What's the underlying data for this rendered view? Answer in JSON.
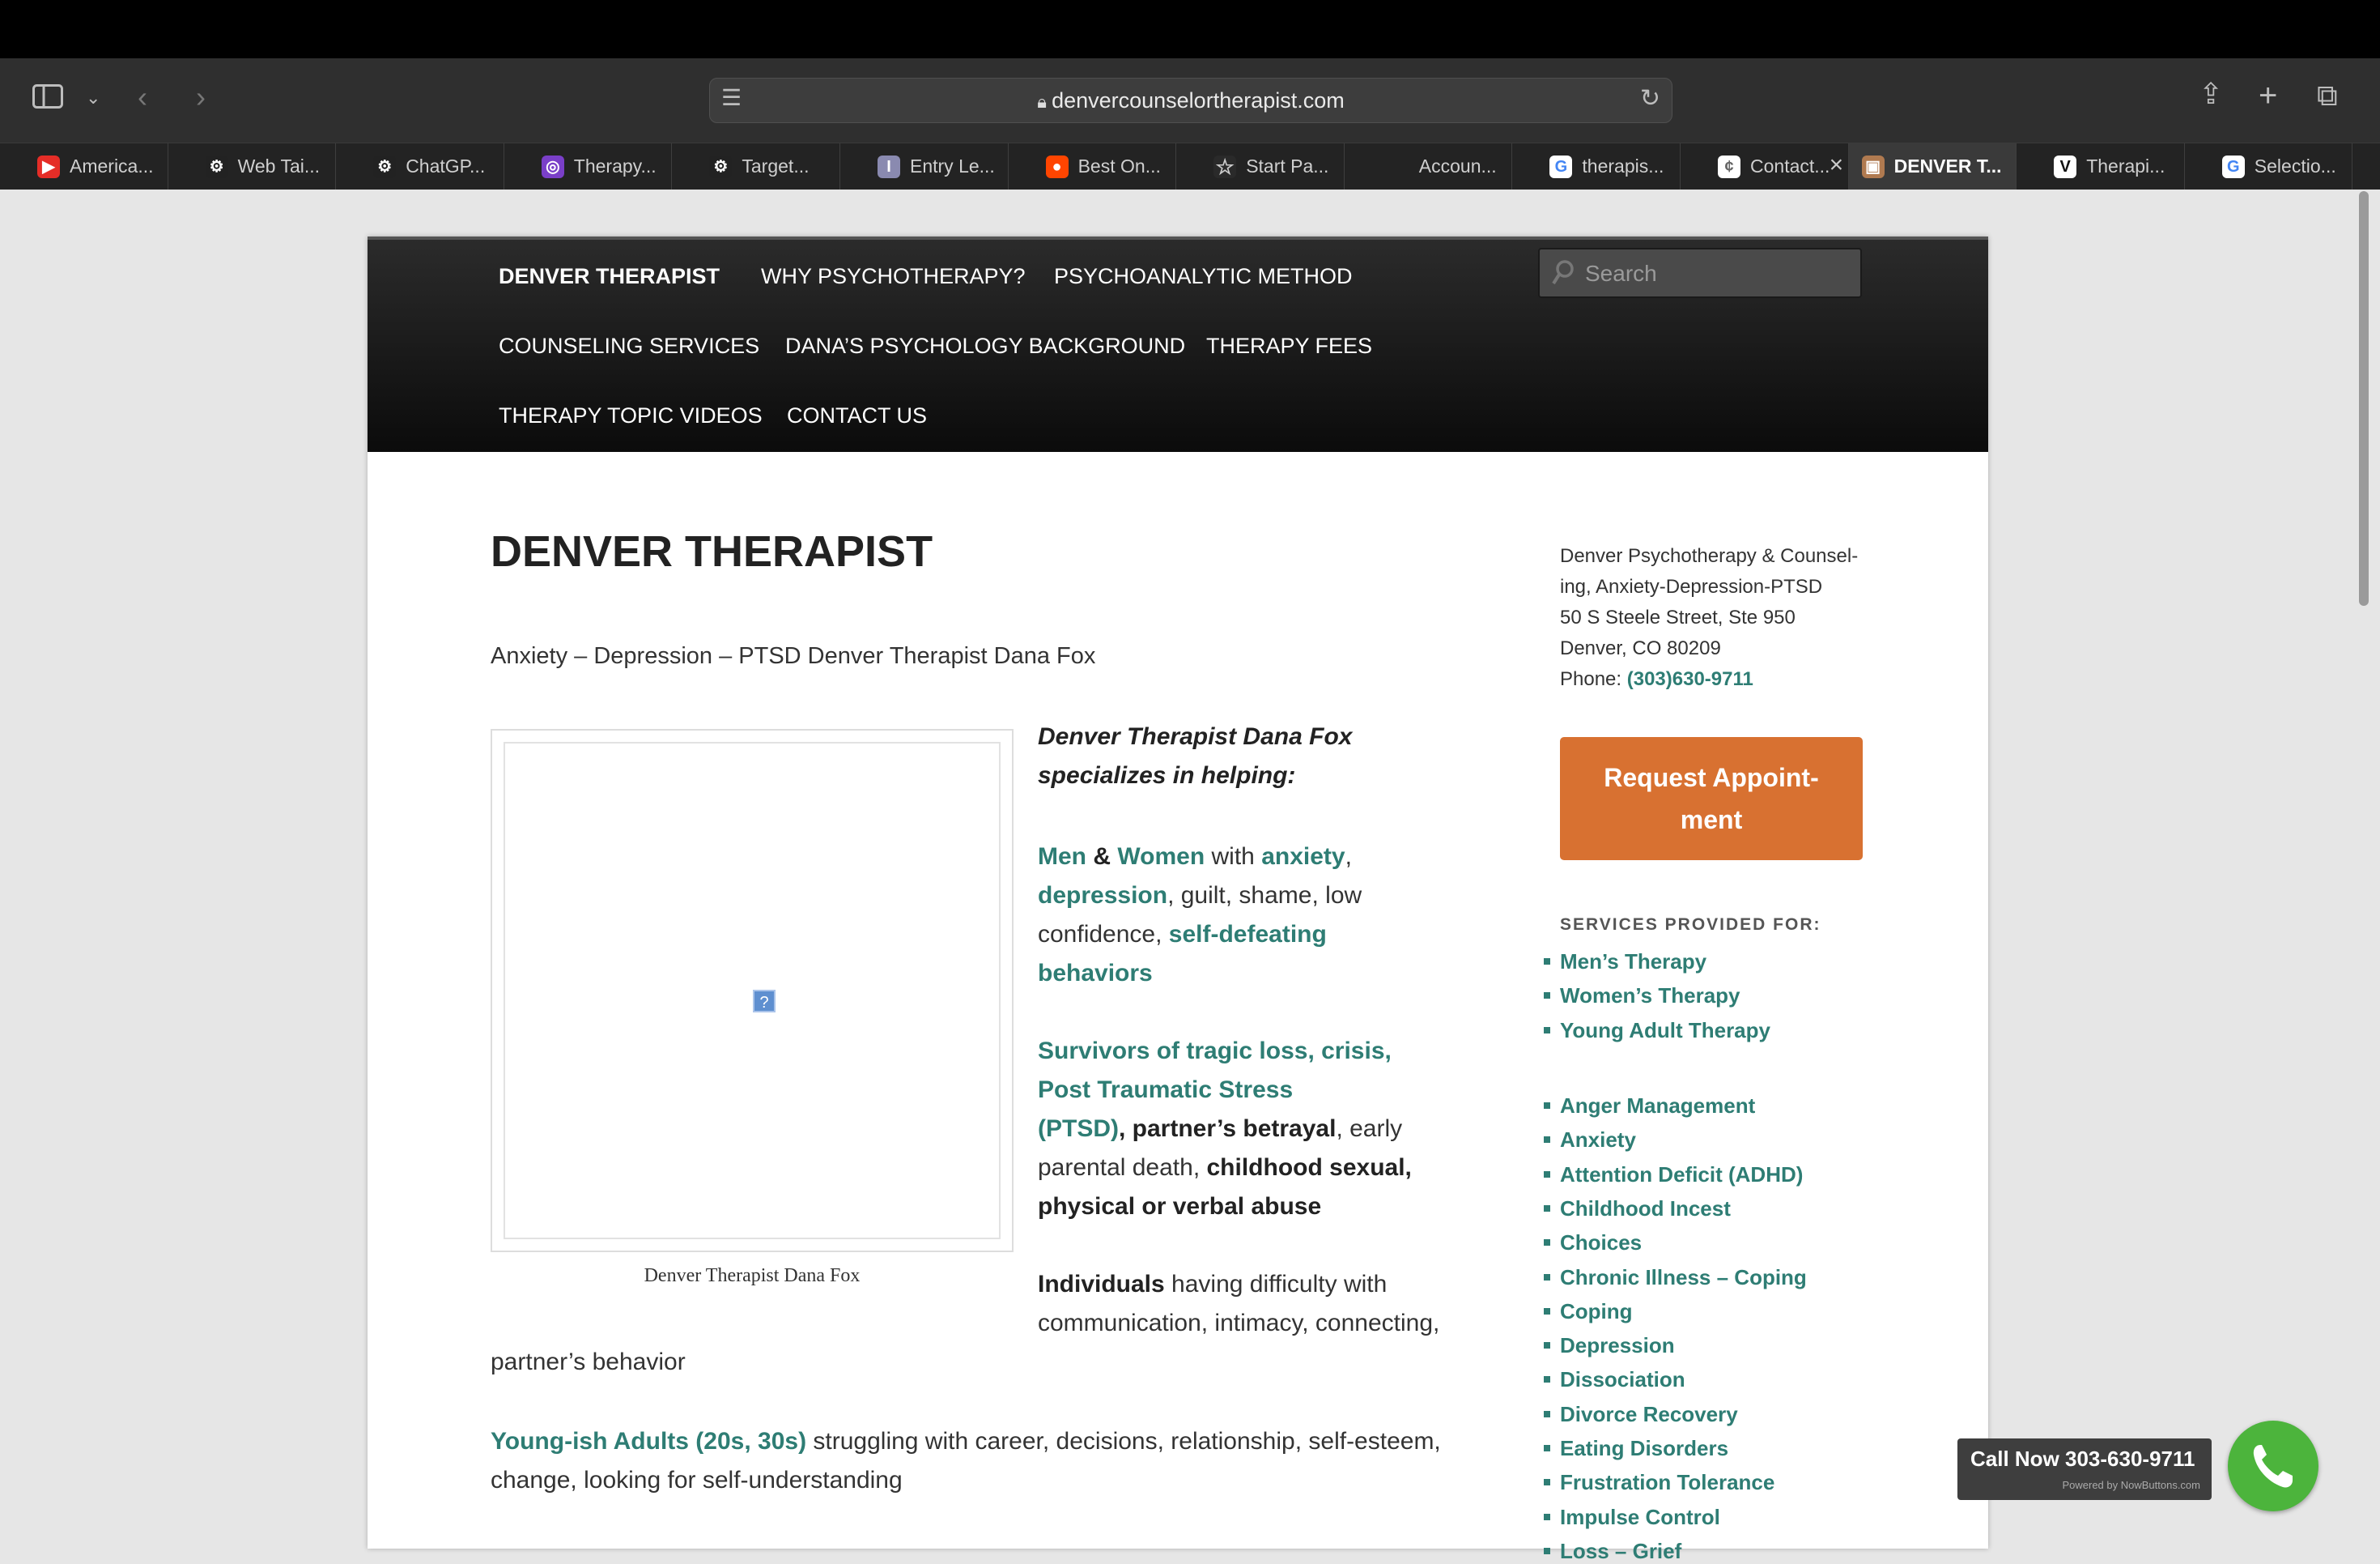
{
  "browser": {
    "url": "denvercounselortherapist.com",
    "tabs": [
      {
        "label": "America...",
        "icon": "youtube-icon",
        "color": "#e52d27"
      },
      {
        "label": "Web Tai...",
        "icon": "openai-icon",
        "color": "#222222"
      },
      {
        "label": "ChatGP...",
        "icon": "openai-icon",
        "color": "#222222"
      },
      {
        "label": "Therapy...",
        "icon": "circle-logo-icon",
        "color": "#7a3fc8"
      },
      {
        "label": "Target...",
        "icon": "openai-icon",
        "color": "#222222"
      },
      {
        "label": "Entry Le...",
        "icon": "i-letter-icon",
        "color": "#8a8ab0"
      },
      {
        "label": "Best On...",
        "icon": "reddit-icon",
        "color": "#ff4500"
      },
      {
        "label": "Start Pa...",
        "icon": "star-icon",
        "color": "#2a2a2a"
      },
      {
        "label": "Accoun...",
        "icon": "",
        "color": "#2a2a2a"
      },
      {
        "label": "therapis...",
        "icon": "google-icon",
        "color": "#ffffff"
      },
      {
        "label": "Contact...",
        "icon": "page-icon",
        "color": "#ffffff"
      },
      {
        "label": "DENVER T...",
        "icon": "site-favicon",
        "color": "#b07a50"
      },
      {
        "label": "Therapi...",
        "icon": "vo-icon",
        "color": "#ffffff"
      },
      {
        "label": "Selectio...",
        "icon": "google-icon",
        "color": "#ffffff"
      }
    ]
  },
  "nav": {
    "items": [
      "DENVER THERAPIST",
      "WHY PSYCHOTHERAPY?",
      "PSYCHOANALYTIC METHOD",
      "COUNSELING SERVICES",
      "DANA’S PSYCHOLOGY BACKGROUND",
      "THERAPY FEES",
      "THERAPY TOPIC VIDEOS",
      "CONTACT US"
    ],
    "search_placeholder": "Search"
  },
  "main": {
    "title": "DENVER THERAPIST",
    "subtitle": "Anxiety – Depression – PTSD Denver Therapist Dana Fox",
    "image_caption": "Denver Therapist Dana Fox",
    "intro_line1": "Denver Therapist  Dana Fox",
    "intro_line2": "specializes in helping:",
    "p1": {
      "men": "Men",
      "amp": "&",
      "women": "Women",
      "with": "with",
      "anxiety": "anxiety",
      "comma1": ",",
      "depression": "depression",
      "guilt": ", guilt, shame, low",
      "confidence": "confidence, ",
      "selfdefeating": "self-defeating",
      "behaviors": "behaviors"
    },
    "p2": {
      "l1": "Survivors of tragic loss, crisis,",
      "l2": "Post Traumatic Stress",
      "l3a": "(PTSD)",
      "l3b": ", partner’s betrayal",
      "l3c": ", early",
      "l4a": "parental death, ",
      "l4b": "childhood sexual,",
      "l5": "physical or verbal abuse"
    },
    "p3": {
      "individuals": "Individuals",
      "l1rest": " having difficulty with",
      "l2": "communication, intimacy, connecting,",
      "l3": "partner’s behavior"
    },
    "p4": {
      "young": "Young-ish Adults (20s, 30s)",
      "l1rest": " struggling with career, decisions, relationship, self-esteem,",
      "l2": "change, looking for self-understanding"
    }
  },
  "sidebar": {
    "address_lines": [
      "Denver Psychotherapy & Counsel-",
      "ing, Anxiety-Depression-PTSD",
      "50 S Steele Street, Ste 950",
      "Denver, CO 80209"
    ],
    "phone_label": "Phone: ",
    "phone": "(303)630-9711",
    "request_button_l1": "Request Appoint-",
    "request_button_l2": "ment",
    "services_heading": "SERVICES PROVIDED FOR:",
    "services_group1": [
      "Men’s Therapy",
      "Women’s Therapy",
      "Young Adult Therapy"
    ],
    "services_group2": [
      "Anger Management",
      "Anxiety",
      "Attention Deficit (ADHD)",
      "Childhood Incest",
      "Choices",
      "Chronic Illness – Coping",
      "Coping",
      "Depression",
      "Dissociation",
      "Divorce Recovery",
      "Eating Disorders",
      "Frustration Tolerance",
      "Impulse Control",
      "Loss – Grief"
    ]
  },
  "call_widget": {
    "text": "Call Now 303-630-9711",
    "powered": "Powered by NowButtons.com"
  },
  "colors": {
    "accent_green": "#2e7d74",
    "button_orange": "#d87131",
    "call_green": "#4cb43c"
  }
}
